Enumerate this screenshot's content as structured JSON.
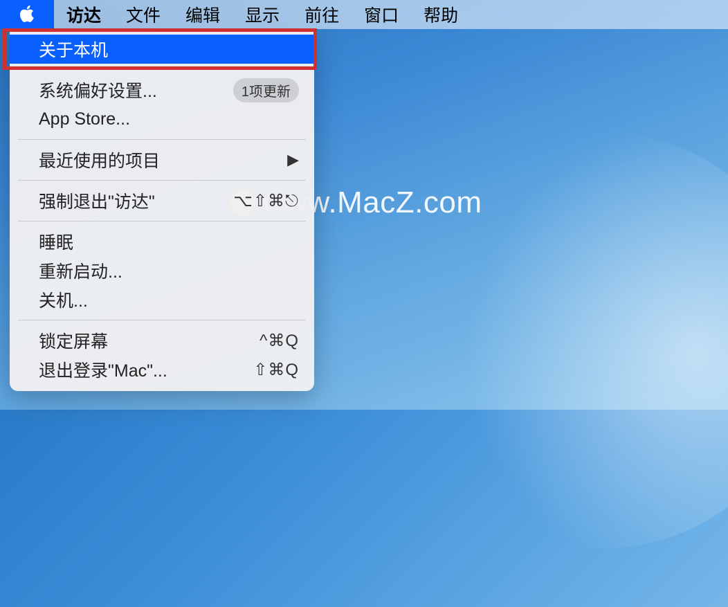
{
  "menubar": {
    "app_name": "访达",
    "items": [
      "文件",
      "编辑",
      "显示",
      "前往",
      "窗口",
      "帮助"
    ]
  },
  "apple_menu": {
    "about": "关于本机",
    "system_prefs": "系统偏好设置...",
    "system_prefs_badge": "1项更新",
    "app_store": "App Store...",
    "recent_items": "最近使用的项目",
    "force_quit": "强制退出\"访达\"",
    "force_quit_shortcut": "⌥⇧⌘⎋",
    "sleep": "睡眠",
    "restart": "重新启动...",
    "shutdown": "关机...",
    "lock_screen": "锁定屏幕",
    "lock_screen_shortcut": "^⌘Q",
    "logout": "退出登录\"Mac\"...",
    "logout_shortcut": "⇧⌘Q"
  },
  "watermark": {
    "z": "Z",
    "text": "www.MacZ.com"
  }
}
